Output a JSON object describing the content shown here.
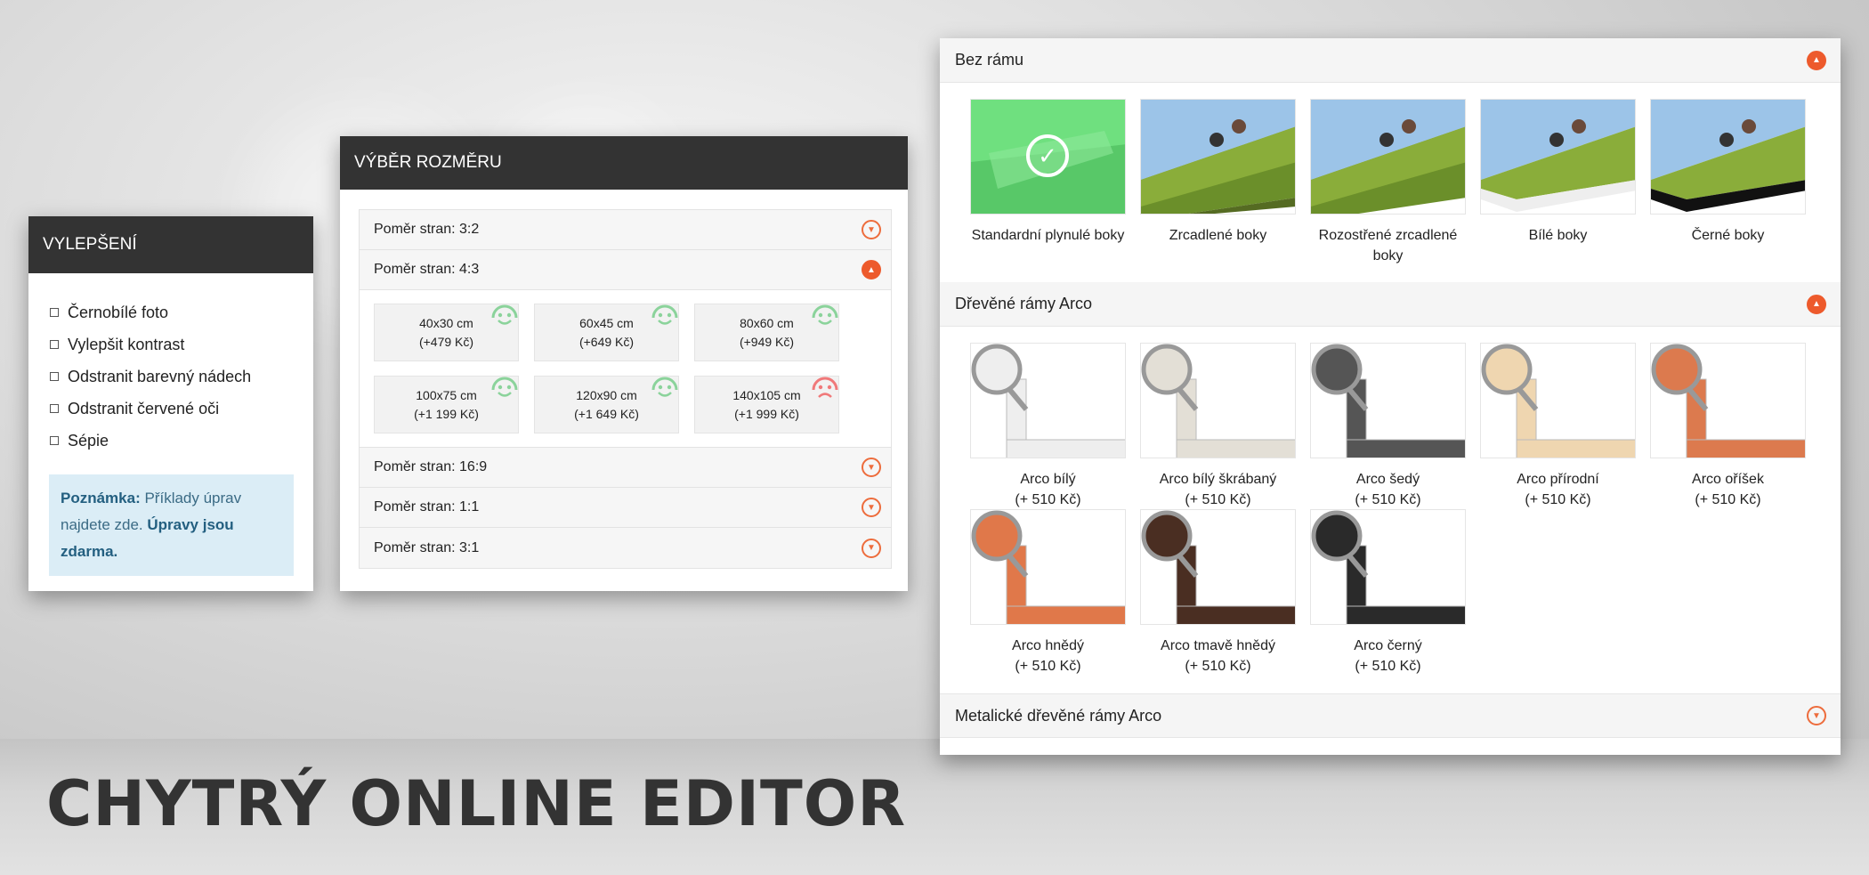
{
  "headline": "CHYTRÝ ONLINE EDITOR",
  "colors": {
    "accent": "#ed5a2c",
    "header_bg": "#333333",
    "selected": "#6fe07f",
    "happy": "#8bd39b",
    "sad": "#f0797a",
    "note_bg": "#dbedf6"
  },
  "enhancements": {
    "title": "VYLEPŠENÍ",
    "items": [
      "Černobílé foto",
      "Vylepšit kontrast",
      "Odstranit barevný nádech",
      "Odstranit červené oči",
      "Sépie"
    ],
    "note": {
      "label": "Poznámka:",
      "text1": " Příklady úprav najdete ",
      "text2": "zde.",
      "text3": " ",
      "bold": "Úpravy jsou zdarma."
    }
  },
  "sizes": {
    "title": "VÝBĚR ROZMĚRU",
    "ratios": [
      {
        "label": "Poměr stran: 3:2",
        "icon": "chevron-down-icon"
      },
      {
        "label": "Poměr stran: 4:3",
        "icon": "chevron-up-icon"
      },
      {
        "label": "Poměr stran: 16:9",
        "icon": "chevron-down-icon"
      },
      {
        "label": "Poměr stran: 1:1",
        "icon": "chevron-down-icon"
      },
      {
        "label": "Poměr stran: 3:1",
        "icon": "chevron-down-icon"
      }
    ],
    "options": [
      {
        "size": "40x30 cm",
        "price": "(+479 Kč)",
        "icon": "happy-smiley-icon"
      },
      {
        "size": "60x45 cm",
        "price": "(+649 Kč)",
        "icon": "happy-smiley-icon"
      },
      {
        "size": "80x60 cm",
        "price": "(+949 Kč)",
        "icon": "happy-smiley-icon"
      },
      {
        "size": "100x75 cm",
        "price": "(+1 199 Kč)",
        "icon": "happy-smiley-icon"
      },
      {
        "size": "120x90 cm",
        "price": "(+1 649 Kč)",
        "icon": "happy-smiley-icon"
      },
      {
        "size": "140x105 cm",
        "price": "(+1 999 Kč)",
        "icon": "sad-smiley-icon"
      }
    ]
  },
  "frames": {
    "no_frame": {
      "title": "Bez rámu",
      "options": [
        {
          "label": "Standardní plynulé boky",
          "selected": true
        },
        {
          "label": "Zrcadlené boky"
        },
        {
          "label": "Rozostřené zrcadlené boky"
        },
        {
          "label": "Bílé boky"
        },
        {
          "label": "Černé boky"
        }
      ]
    },
    "wood": {
      "title": "Dřevěné rámy Arco",
      "options": [
        {
          "label": "Arco bílý",
          "price": "(+ 510 Kč)",
          "color": "#eeeeee"
        },
        {
          "label": "Arco bílý škrábaný",
          "price": "(+ 510 Kč)",
          "color": "#e3dfd6"
        },
        {
          "label": "Arco šedý",
          "price": "(+ 510 Kč)",
          "color": "#555555"
        },
        {
          "label": "Arco přírodní",
          "price": "(+ 510 Kč)",
          "color": "#efd6b0"
        },
        {
          "label": "Arco oříšek",
          "price": "(+ 510 Kč)",
          "color": "#dc7a4e"
        },
        {
          "label": "Arco hnědý",
          "price": "(+ 510 Kč)",
          "color": "#e0784a"
        },
        {
          "label": "Arco tmavě hnědý",
          "price": "(+ 510 Kč)",
          "color": "#4a2e22"
        },
        {
          "label": "Arco černý",
          "price": "(+ 510 Kč)",
          "color": "#2a2a2a"
        }
      ]
    },
    "metallic": {
      "title": "Metalické dřevěné rámy Arco"
    }
  }
}
